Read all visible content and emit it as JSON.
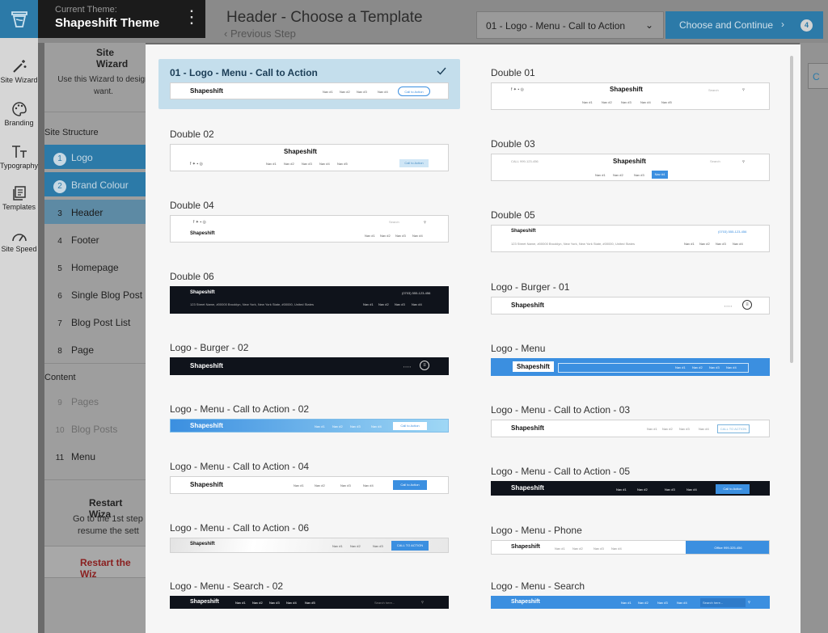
{
  "sidebar": {
    "items": [
      {
        "label": "Site Wizard",
        "icon": "magic-wand-icon"
      },
      {
        "label": "Branding",
        "icon": "palette-icon"
      },
      {
        "label": "Typography",
        "icon": "typography-icon"
      },
      {
        "label": "Templates",
        "icon": "templates-icon"
      },
      {
        "label": "Site Speed",
        "icon": "speedometer-icon"
      }
    ]
  },
  "theme": {
    "label": "Current Theme:",
    "name": "Shapeshift Theme"
  },
  "header": {
    "title": "Header - Choose a Template",
    "previous_step": "Previous Step"
  },
  "template_select": {
    "value": "01 - Logo - Menu - Call to Action"
  },
  "choose_button": {
    "label": "Choose and Continue",
    "step_badge": "4"
  },
  "wizard": {
    "title": "Site Wizard",
    "description": "Use this Wizard to design want.",
    "site_structure_heading": "Site Structure",
    "content_heading": "Content",
    "steps": [
      {
        "num": "1",
        "label": "Logo"
      },
      {
        "num": "2",
        "label": "Brand Colour"
      },
      {
        "num": "3",
        "label": "Header"
      },
      {
        "num": "4",
        "label": "Footer"
      },
      {
        "num": "5",
        "label": "Homepage"
      },
      {
        "num": "6",
        "label": "Single Blog Post"
      },
      {
        "num": "7",
        "label": "Blog Post List"
      },
      {
        "num": "8",
        "label": "Page"
      }
    ],
    "content_steps": [
      {
        "num": "9",
        "label": "Pages"
      },
      {
        "num": "10",
        "label": "Blog Posts"
      },
      {
        "num": "11",
        "label": "Menu"
      }
    ],
    "restart_title": "Restart Wiza",
    "restart_desc_1": "Go to the 1st step",
    "restart_desc_2": "resume the sett",
    "restart_button": "Restart the Wiz"
  },
  "right_partial": "C",
  "preview_text": {
    "logo": "Shapeshift",
    "nav": [
      "Nav #1",
      "Nav #2",
      "Nav #3",
      "Nav #4",
      "Nav #5"
    ],
    "cta": "Call to Action",
    "cta_upper": "CALL TO ACTION",
    "search": "Search",
    "search_dots": "Search here...",
    "phone": "(0703) 555-123-456",
    "office": "Office 999-325-456",
    "address": "123 Street Name, #00000 Brooklyn, New York, New York State, #00000, United States",
    "callus": "CALL 999-123-456"
  },
  "templates": [
    {
      "id": "t01",
      "label": "01 - Logo - Menu - Call to Action",
      "selected": true
    },
    {
      "id": "double01",
      "label": "Double 01"
    },
    {
      "id": "double02",
      "label": "Double 02"
    },
    {
      "id": "double03",
      "label": "Double 03"
    },
    {
      "id": "double04",
      "label": "Double 04"
    },
    {
      "id": "double05",
      "label": "Double 05"
    },
    {
      "id": "double06",
      "label": "Double 06"
    },
    {
      "id": "burger01",
      "label": "Logo - Burger - 01"
    },
    {
      "id": "burger02",
      "label": "Logo - Burger - 02"
    },
    {
      "id": "menu",
      "label": "Logo - Menu"
    },
    {
      "id": "mcta02",
      "label": "Logo - Menu - Call to Action - 02"
    },
    {
      "id": "mcta03",
      "label": "Logo - Menu - Call to Action - 03"
    },
    {
      "id": "mcta04",
      "label": "Logo - Menu - Call to Action - 04"
    },
    {
      "id": "mcta05",
      "label": "Logo - Menu - Call to Action - 05"
    },
    {
      "id": "mcta06",
      "label": "Logo - Menu - Call to Action - 06"
    },
    {
      "id": "mphone",
      "label": "Logo - Menu - Phone"
    },
    {
      "id": "msearch02",
      "label": "Logo - Menu - Search - 02"
    },
    {
      "id": "msearch",
      "label": "Logo - Menu - Search"
    }
  ],
  "colors": {
    "accent": "#2c7aa8",
    "selected_card": "#c4deec",
    "preview_blue": "#3b8fe0",
    "preview_dark": "#0f131b"
  }
}
